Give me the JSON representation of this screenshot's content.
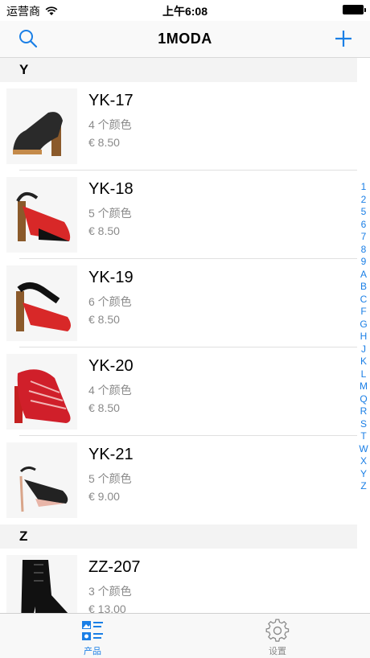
{
  "status_bar": {
    "carrier": "运营商",
    "time": "上午6:08"
  },
  "nav": {
    "title": "1MODA",
    "search_icon": "search-icon",
    "add_icon": "plus-icon"
  },
  "sections": [
    {
      "letter": "Y"
    },
    {
      "letter": "Z"
    }
  ],
  "products": [
    {
      "code": "YK-17",
      "colors": "4 个颜色",
      "price": "€ 8.50",
      "shoe_color": "#2a2a2a"
    },
    {
      "code": "YK-18",
      "colors": "5 个颜色",
      "price": "€ 8.50",
      "shoe_color": "#d82828"
    },
    {
      "code": "YK-19",
      "colors": "6 个颜色",
      "price": "€ 8.50",
      "shoe_color": "#d82828"
    },
    {
      "code": "YK-20",
      "colors": "4 个颜色",
      "price": "€ 8.50",
      "shoe_color": "#d01f2a"
    },
    {
      "code": "YK-21",
      "colors": "5 个颜色",
      "price": "€ 9.00",
      "shoe_color": "#222222"
    },
    {
      "code": "ZZ-207",
      "colors": "3 个颜色",
      "price": "€ 13.00",
      "shoe_color": "#111111"
    }
  ],
  "index_letters": [
    "1",
    "2",
    "5",
    "6",
    "7",
    "8",
    "9",
    "A",
    "B",
    "C",
    "F",
    "G",
    "H",
    "J",
    "K",
    "L",
    "M",
    "Q",
    "R",
    "S",
    "T",
    "W",
    "X",
    "Y",
    "Z"
  ],
  "tabs": [
    {
      "label": "产品",
      "icon": "product-list-icon",
      "active": true
    },
    {
      "label": "设置",
      "icon": "gear-icon",
      "active": false
    }
  ],
  "colors": {
    "accent": "#1a7fe6"
  }
}
